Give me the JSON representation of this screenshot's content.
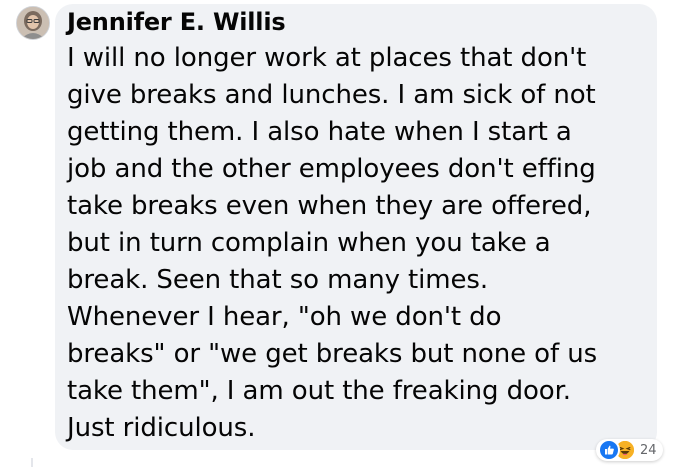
{
  "comment": {
    "author": "Jennifer E. Willis",
    "avatar_icon": "profile-photo",
    "text": "I will no longer work at places that don't\ngive breaks and lunches. I am sick of not\ngetting them. I also hate when I start a\njob and the other employees don't effing\ntake breaks even when they are offered,\nbut in turn complain when you take a\nbreak. Seen that so many times.\nWhenever I hear, \"oh we don't do\nbreaks\" or \"we get breaks but none of us\ntake them\", I am out the freaking door.\nJust ridiculous.",
    "reactions": {
      "icons": [
        "like-icon",
        "haha-icon"
      ],
      "count": "24"
    }
  },
  "colors": {
    "bubble_background": "#f0f2f5",
    "text": "#050505",
    "like_blue": "#1877f2",
    "haha_yellow": "#f7b125",
    "count_gray": "#65676b"
  }
}
